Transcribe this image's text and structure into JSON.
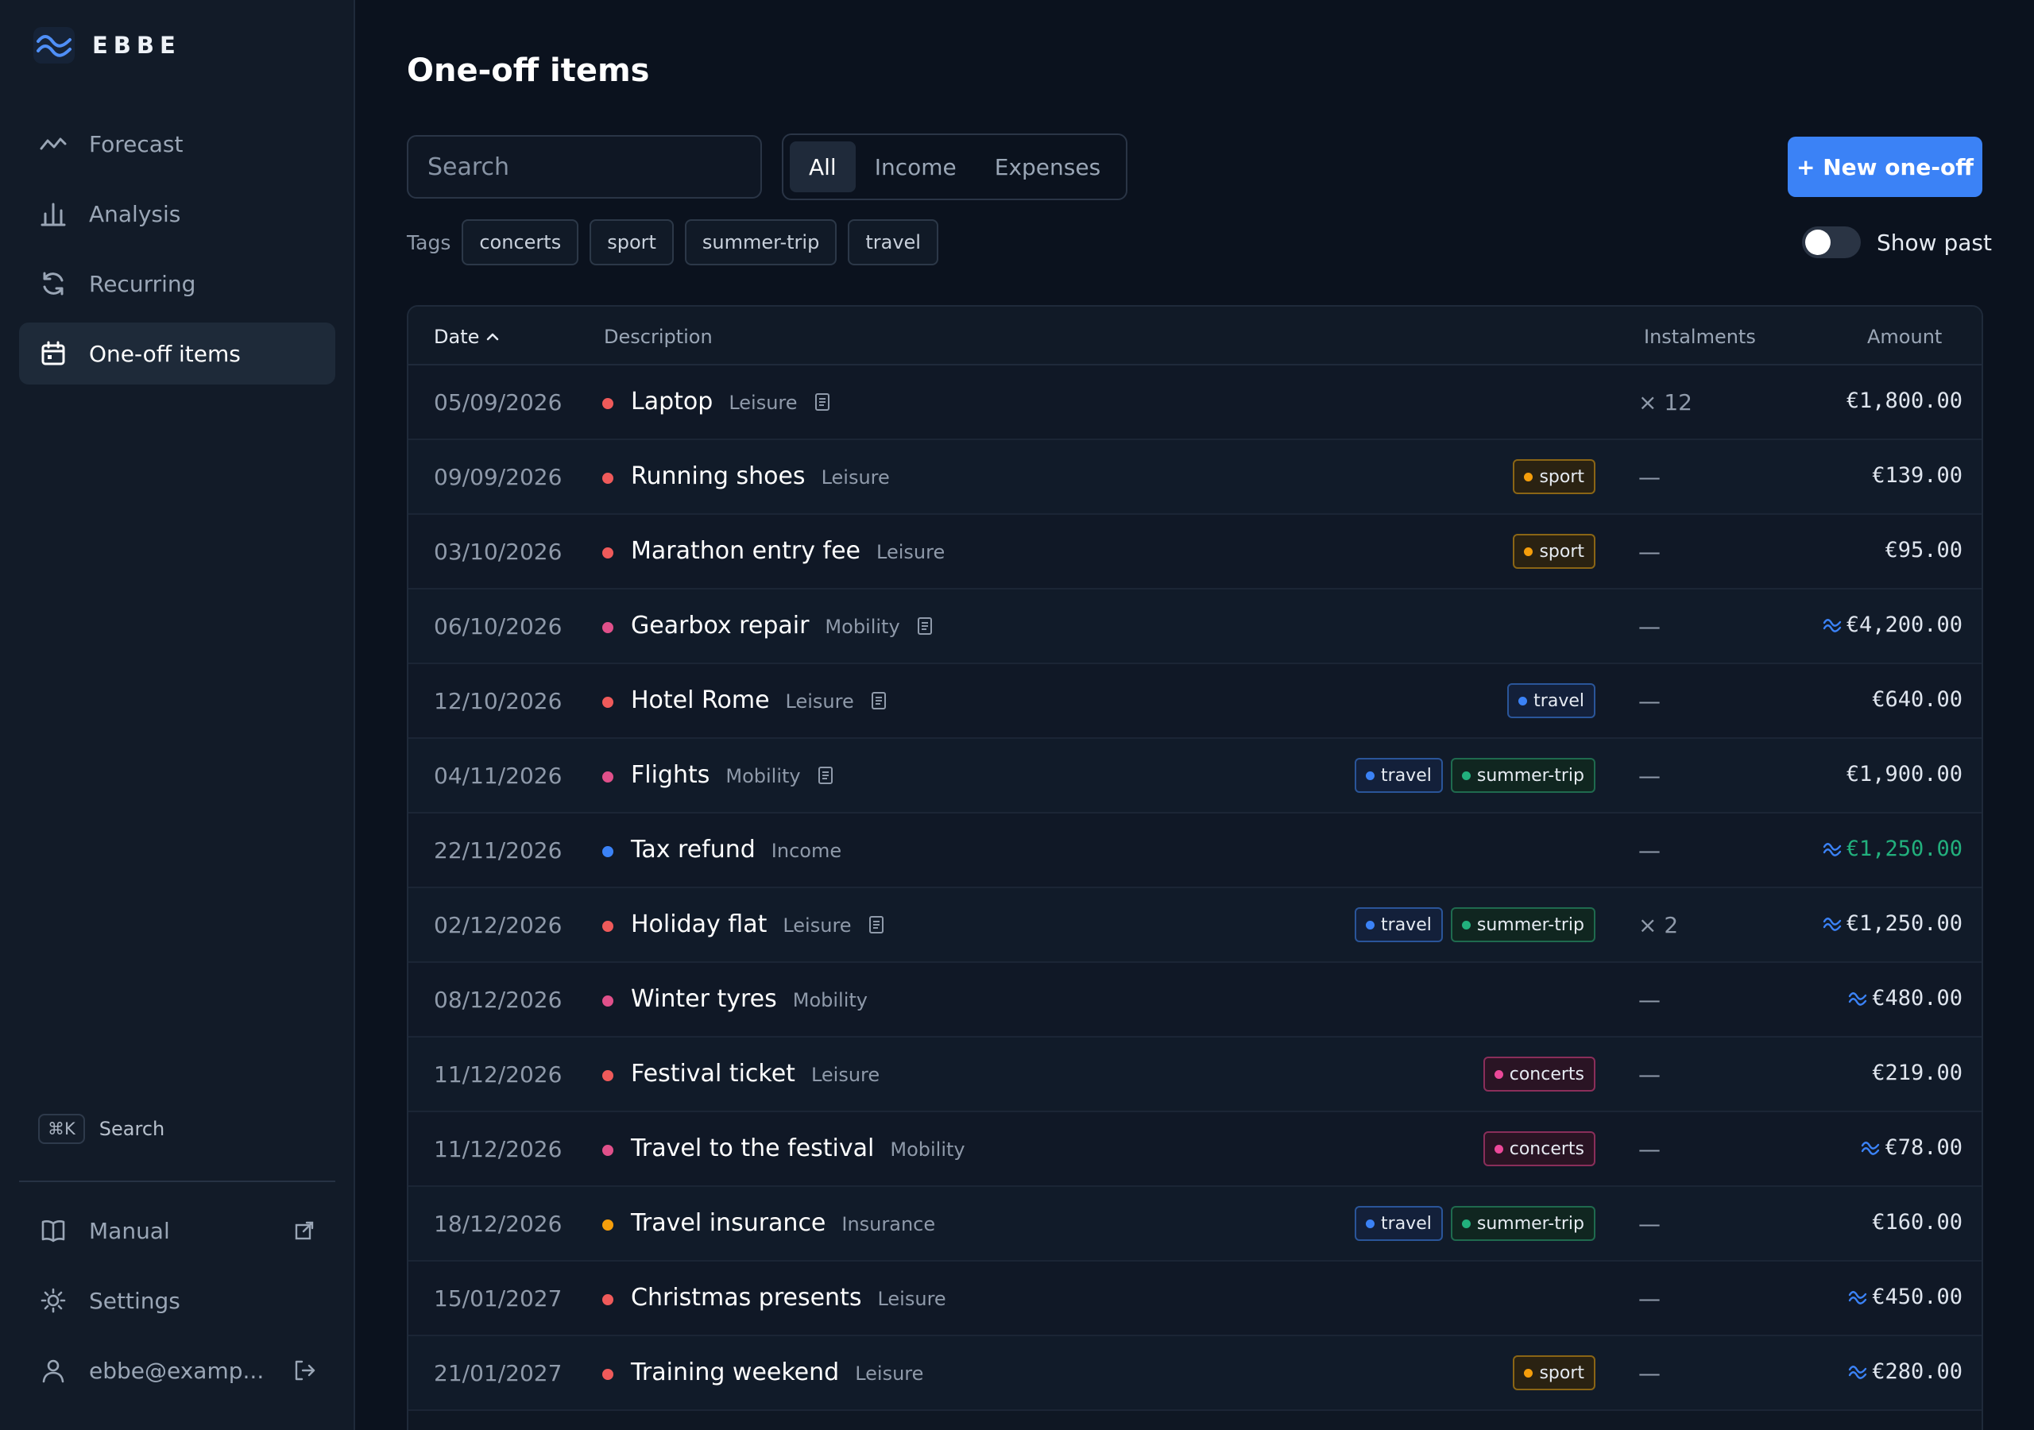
{
  "app": {
    "name": "EBBE"
  },
  "nav": [
    {
      "label": "Forecast",
      "icon": "forecast-icon",
      "active": false
    },
    {
      "label": "Analysis",
      "icon": "bar-chart-icon",
      "active": false
    },
    {
      "label": "Recurring",
      "icon": "refresh-icon",
      "active": false
    },
    {
      "label": "One-off items",
      "icon": "calendar-icon",
      "active": true
    }
  ],
  "quick_search": {
    "shortcut": "⌘K",
    "label": "Search"
  },
  "bottom_nav": {
    "manual": "Manual",
    "settings": "Settings",
    "user": "ebbe@examp..."
  },
  "page": {
    "title": "One-off items",
    "search_placeholder": "Search",
    "filters": [
      "All",
      "Income",
      "Expenses"
    ],
    "active_filter": "All",
    "new_button": "+ New one-off",
    "tags_label": "Tags",
    "tags": [
      "concerts",
      "sport",
      "summer-trip",
      "travel"
    ],
    "show_past_label": "Show past",
    "show_past": false
  },
  "table": {
    "headers": {
      "date": "Date",
      "description": "Description",
      "instalments": "Instalments",
      "amount": "Amount"
    },
    "rows": [
      {
        "date": "05/09/2026",
        "title": "Laptop",
        "category": "Leisure",
        "color": "#ef5a5a",
        "note": true,
        "tags": [],
        "instalments": "× 12",
        "amount": "€1,800.00",
        "wave": false,
        "income": false
      },
      {
        "date": "09/09/2026",
        "title": "Running shoes",
        "category": "Leisure",
        "color": "#ef5a5a",
        "note": false,
        "tags": [
          "sport"
        ],
        "instalments": "—",
        "amount": "€139.00",
        "wave": false,
        "income": false
      },
      {
        "date": "03/10/2026",
        "title": "Marathon entry fee",
        "category": "Leisure",
        "color": "#ef5a5a",
        "note": false,
        "tags": [
          "sport"
        ],
        "instalments": "—",
        "amount": "€95.00",
        "wave": false,
        "income": false
      },
      {
        "date": "06/10/2026",
        "title": "Gearbox repair",
        "category": "Mobility",
        "color": "#e0508a",
        "note": true,
        "tags": [],
        "instalments": "—",
        "amount": "€4,200.00",
        "wave": true,
        "income": false
      },
      {
        "date": "12/10/2026",
        "title": "Hotel Rome",
        "category": "Leisure",
        "color": "#ef5a5a",
        "note": true,
        "tags": [
          "travel"
        ],
        "instalments": "—",
        "amount": "€640.00",
        "wave": false,
        "income": false
      },
      {
        "date": "04/11/2026",
        "title": "Flights",
        "category": "Mobility",
        "color": "#e0508a",
        "note": true,
        "tags": [
          "travel",
          "summer-trip"
        ],
        "instalments": "—",
        "amount": "€1,900.00",
        "wave": false,
        "income": false
      },
      {
        "date": "22/11/2026",
        "title": "Tax refund",
        "category": "Income",
        "color": "#3b82f6",
        "note": false,
        "tags": [],
        "instalments": "—",
        "amount": "€1,250.00",
        "wave": true,
        "income": true
      },
      {
        "date": "02/12/2026",
        "title": "Holiday flat",
        "category": "Leisure",
        "color": "#ef5a5a",
        "note": true,
        "tags": [
          "travel",
          "summer-trip"
        ],
        "instalments": "× 2",
        "amount": "€1,250.00",
        "wave": true,
        "income": false
      },
      {
        "date": "08/12/2026",
        "title": "Winter tyres",
        "category": "Mobility",
        "color": "#e0508a",
        "note": false,
        "tags": [],
        "instalments": "—",
        "amount": "€480.00",
        "wave": true,
        "income": false
      },
      {
        "date": "11/12/2026",
        "title": "Festival ticket",
        "category": "Leisure",
        "color": "#ef5a5a",
        "note": false,
        "tags": [
          "concerts"
        ],
        "instalments": "—",
        "amount": "€219.00",
        "wave": false,
        "income": false
      },
      {
        "date": "11/12/2026",
        "title": "Travel to the festival",
        "category": "Mobility",
        "color": "#e0508a",
        "note": false,
        "tags": [
          "concerts"
        ],
        "instalments": "—",
        "amount": "€78.00",
        "wave": true,
        "income": false
      },
      {
        "date": "18/12/2026",
        "title": "Travel insurance",
        "category": "Insurance",
        "color": "#f59e0b",
        "note": false,
        "tags": [
          "travel",
          "summer-trip"
        ],
        "instalments": "—",
        "amount": "€160.00",
        "wave": false,
        "income": false
      },
      {
        "date": "15/01/2027",
        "title": "Christmas presents",
        "category": "Leisure",
        "color": "#ef5a5a",
        "note": false,
        "tags": [],
        "instalments": "—",
        "amount": "€450.00",
        "wave": true,
        "income": false
      },
      {
        "date": "21/01/2027",
        "title": "Training weekend",
        "category": "Leisure",
        "color": "#ef5a5a",
        "note": false,
        "tags": [
          "sport"
        ],
        "instalments": "—",
        "amount": "€280.00",
        "wave": true,
        "income": false
      }
    ]
  },
  "tag_styles": {
    "sport": {
      "border": "#8a6515",
      "bg": "#2a2212",
      "dot": "#f59e0b"
    },
    "travel": {
      "border": "#2a5599",
      "bg": "#13203a",
      "dot": "#3b82f6"
    },
    "summer-trip": {
      "border": "#1f6a4e",
      "bg": "#102620",
      "dot": "#22b07d"
    },
    "concerts": {
      "border": "#8a2e5a",
      "bg": "#2a1424",
      "dot": "#ec4899"
    }
  },
  "colors": {
    "accent": "#3b82f6",
    "income": "#22b07d",
    "wave": "#3b82f6"
  }
}
